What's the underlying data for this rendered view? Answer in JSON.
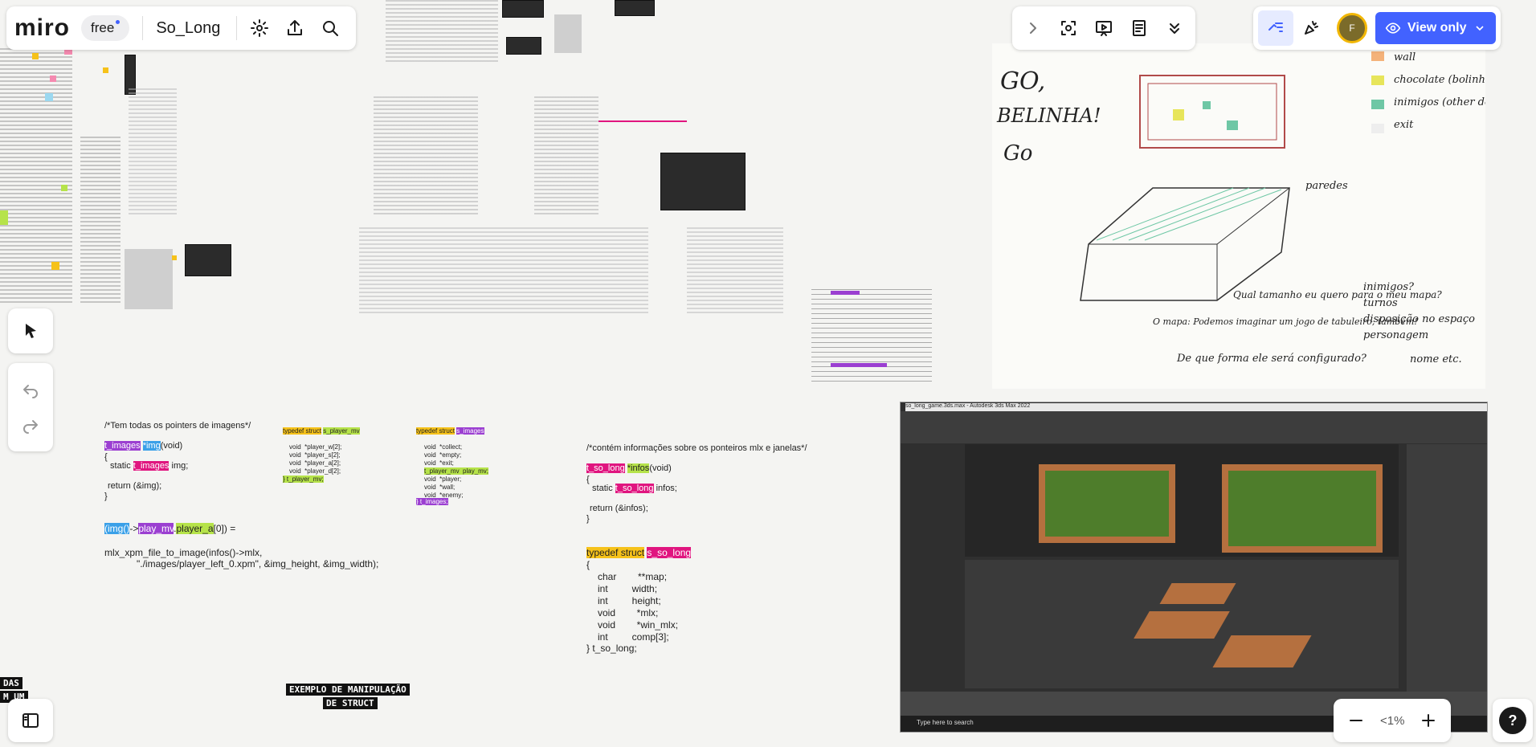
{
  "app": {
    "logo_text": "miro",
    "plan_badge": "free",
    "board_title": "So_Long",
    "view_mode_label": "View only",
    "avatar_initial": "F",
    "zoom_level": "<1%",
    "help_label": "?"
  },
  "board": {
    "heading_so_long": "s_so_long",
    "notes": {
      "images_comment": "/*Tem todas os pointers de imagens*/",
      "images_func": "t_images *img(void)",
      "images_static": "static t_images img;",
      "images_return": "return (&img);",
      "usage_line": "(img()->play_mv.player_a[0]) =",
      "mlx_line1": "mlx_xpm_file_to_image(infos()->mlx,",
      "mlx_line2": "\"./images/player_left_0.xpm\", &img_height, &img_width);",
      "infos_comment": "/*contém informações sobre os ponteiros mlx e janelas*/",
      "infos_func": "t_so_long *infos(void)",
      "infos_static": "static t_so_long infos;",
      "infos_return": "return (&infos);",
      "struct_header": "typedef struct s_so_long",
      "struct_fields": [
        "char        **map;",
        "int         width;",
        "int         height;",
        "void        *mlx;",
        "void        *win_mlx;",
        "int         comp[3];"
      ],
      "struct_end": "} t_so_long;",
      "player_struct_header": "typedef struct s_player_mv",
      "player_struct_fields": [
        "void  *player_w[2];",
        "void  *player_s[2];",
        "void  *player_a[2];",
        "void  *player_d[2];"
      ],
      "player_struct_end": "} t_player_mv;",
      "images_struct_header": "typedef struct s_images",
      "images_struct_fields": [
        "void  *collect;",
        "void  *empty;",
        "void  *exit;",
        "t_player_mv  play_mv;",
        "void  *player;",
        "void  *wall;",
        "void  *enemy;"
      ],
      "images_struct_end": "} t_images;",
      "example_label_1": "EXEMPLO DE MANIPULAÇÃO",
      "example_label_2": "DE STRUCT",
      "left_label_1": "DAS",
      "left_label_2": "M UM"
    },
    "sketch": {
      "go1": "GO,",
      "go2": "BELINHA!",
      "go3": "Go",
      "legend": [
        "wall",
        "chocolate (bolinha)",
        "inimigos (other dogs)",
        "exit"
      ],
      "paredes": "paredes",
      "note1": "Qual tamanho eu quero para o meu mapa?",
      "note2": "O mapa: Podemos imaginar um jogo de tabuleiro, também!",
      "note3": "De que forma ele será configurado?",
      "bullets": [
        "inimigos?",
        "turnos",
        "disposição no espaço",
        "personagem",
        "nome etc."
      ]
    },
    "screenshot": {
      "title": "so_long_game.3ds.max - Autodesk 3ds Max 2022",
      "taskbar_search": "Type here to search"
    }
  }
}
